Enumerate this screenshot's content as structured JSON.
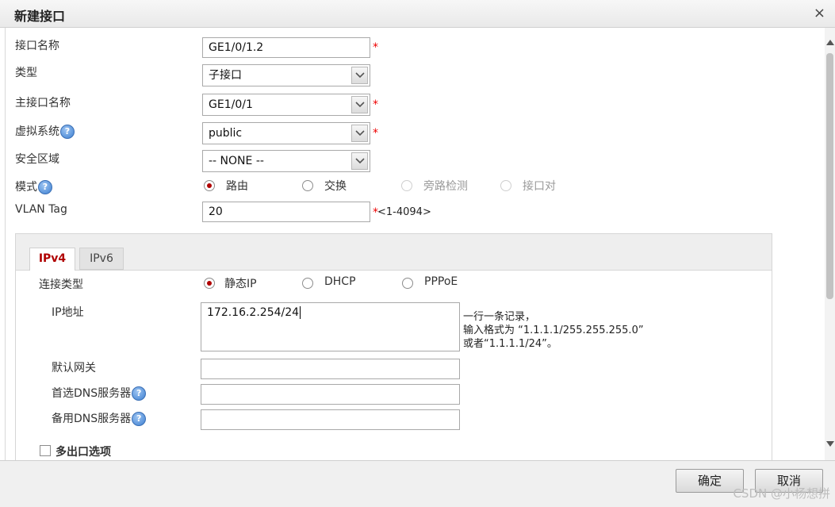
{
  "dialog": {
    "title": "新建接口",
    "close_glyph": "×"
  },
  "form": {
    "iface_name_label": "接口名称",
    "iface_name_value": "GE1/0/1.2",
    "type_label": "类型",
    "type_value": "子接口",
    "parent_label": "主接口名称",
    "parent_value": "GE1/0/1",
    "vsys_label": "虚拟系统",
    "vsys_value": "public",
    "zone_label": "安全区域",
    "zone_value": "-- NONE --",
    "mode_label": "模式",
    "mode_options": [
      "路由",
      "交换",
      "旁路检测",
      "接口对"
    ],
    "mode_selected": "路由",
    "vlan_label": "VLAN Tag",
    "vlan_value": "20",
    "vlan_hint": "<1-4094>",
    "required_mark": "*",
    "help_glyph": "?"
  },
  "tabs": [
    "IPv4",
    "IPv6"
  ],
  "ipv4": {
    "conn_label": "连接类型",
    "conn_options": [
      "静态IP",
      "DHCP",
      "PPPoE"
    ],
    "conn_selected": "静态IP",
    "ip_label": "IP地址",
    "ip_value": "172.16.2.254/24",
    "ip_hint_1": "一行一条记录，",
    "ip_hint_2": "输入格式为 “1.1.1.1/255.255.255.0”",
    "ip_hint_3": "或者“1.1.1.1/24”。",
    "gw_label": "默认网关",
    "gw_value": "",
    "dns1_label": "首选DNS服务器",
    "dns1_value": "",
    "dns2_label": "备用DNS服务器",
    "dns2_value": "",
    "multi_exit_label": "多出口选项"
  },
  "footer": {
    "ok": "确定",
    "cancel": "取消",
    "watermark": "CSDN @小杨想拼"
  }
}
